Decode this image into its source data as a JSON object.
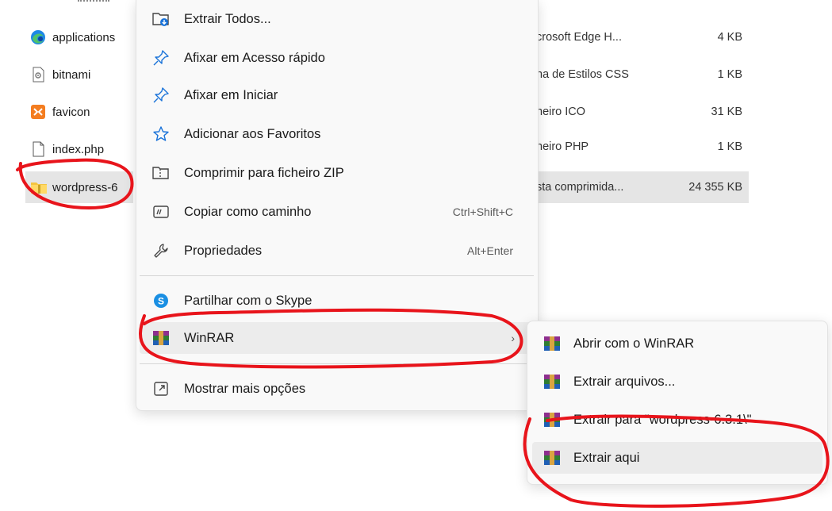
{
  "files": [
    {
      "name": "applications",
      "icon": "edge-html-icon"
    },
    {
      "name": "bitnami",
      "icon": "css-file-icon"
    },
    {
      "name": "favicon",
      "icon": "xampp-icon"
    },
    {
      "name": "index.php",
      "icon": "blank-file-icon"
    },
    {
      "name": "wordpress-6",
      "icon": "zip-folder-icon"
    }
  ],
  "file_meta": [
    {
      "type": "crosoft Edge H...",
      "size": "4 KB"
    },
    {
      "type": "ha de Estilos CSS",
      "size": "1 KB"
    },
    {
      "type": "heiro ICO",
      "size": "31 KB"
    },
    {
      "type": "heiro PHP",
      "size": "1 KB"
    },
    {
      "type": "sta comprimida...",
      "size": "24 355 KB"
    }
  ],
  "context_menu": {
    "items": [
      {
        "label": "Extrair Todos...",
        "icon": "extract-all-icon",
        "shortcut": ""
      },
      {
        "label": "Afixar em Acesso rápido",
        "icon": "pin-icon",
        "shortcut": ""
      },
      {
        "label": "Afixar em Iniciar",
        "icon": "pin-icon",
        "shortcut": ""
      },
      {
        "label": "Adicionar aos Favoritos",
        "icon": "star-icon",
        "shortcut": ""
      },
      {
        "label": "Comprimir para ficheiro ZIP",
        "icon": "zip-icon",
        "shortcut": ""
      },
      {
        "label": "Copiar como caminho",
        "icon": "copy-path-icon",
        "shortcut": "Ctrl+Shift+C"
      },
      {
        "label": "Propriedades",
        "icon": "wrench-icon",
        "shortcut": "Alt+Enter"
      },
      {
        "label": "Partilhar com o Skype",
        "icon": "skype-icon",
        "shortcut": ""
      },
      {
        "label": "WinRAR",
        "icon": "winrar-icon",
        "shortcut": ""
      },
      {
        "label": "Mostrar mais opções",
        "icon": "more-options-icon",
        "shortcut": ""
      }
    ]
  },
  "winrar_submenu": {
    "items": [
      {
        "label": "Abrir com o WinRAR"
      },
      {
        "label": "Extrair arquivos..."
      },
      {
        "label": "Extrair para \"wordpress-6.3.1\\\""
      },
      {
        "label": "Extrair aqui"
      }
    ]
  },
  "colors": {
    "annotation_red": "#e8141b",
    "menu_bg": "#f9f9f9",
    "selection": "#e5e5e5",
    "accent_blue": "#1a73d9"
  }
}
